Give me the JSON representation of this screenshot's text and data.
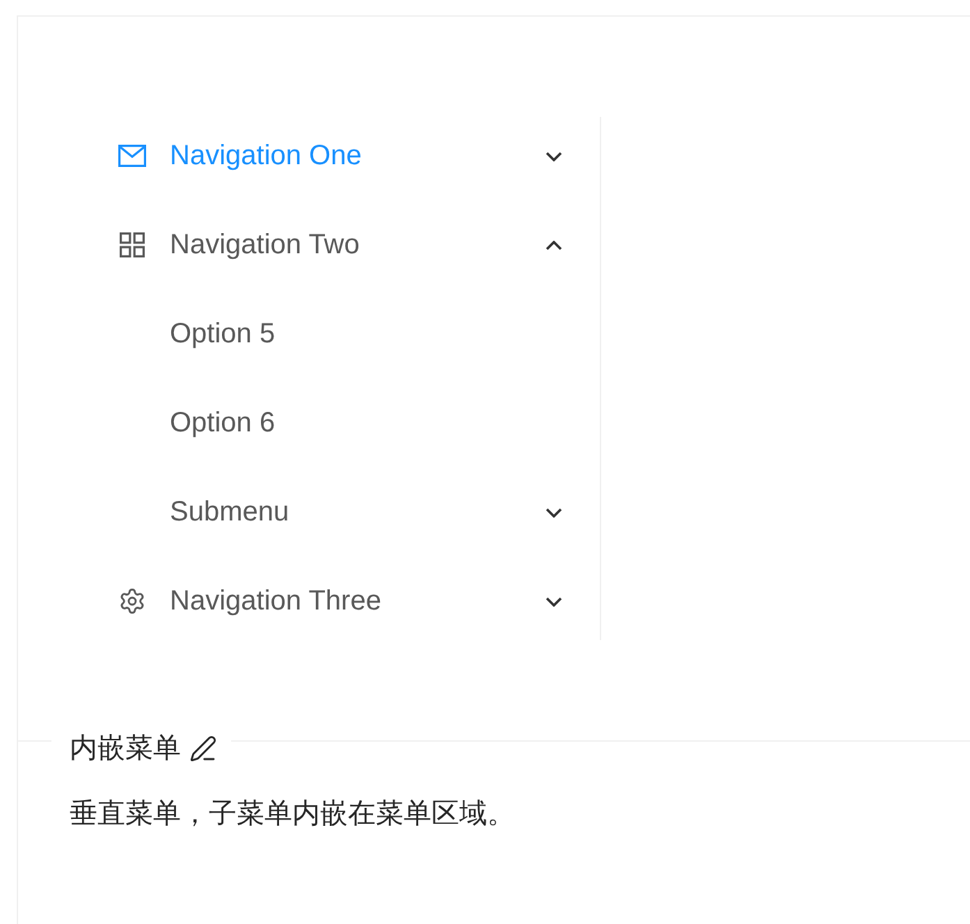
{
  "menu": {
    "items": [
      {
        "kind": "submenu",
        "label": "Navigation One",
        "selected": true,
        "expanded": false
      },
      {
        "kind": "submenu",
        "label": "Navigation Two",
        "selected": false,
        "expanded": true,
        "children": [
          {
            "kind": "item",
            "label": "Option 5",
            "selected": false
          },
          {
            "kind": "item",
            "label": "Option 6",
            "selected": false
          },
          {
            "kind": "submenu",
            "label": "Submenu",
            "selected": false,
            "expanded": false
          }
        ]
      },
      {
        "kind": "submenu",
        "label": "Navigation Three",
        "selected": false,
        "expanded": false
      }
    ]
  },
  "section": {
    "title": "内嵌菜单",
    "description": "垂直菜单，子菜单内嵌在菜单区域。"
  }
}
